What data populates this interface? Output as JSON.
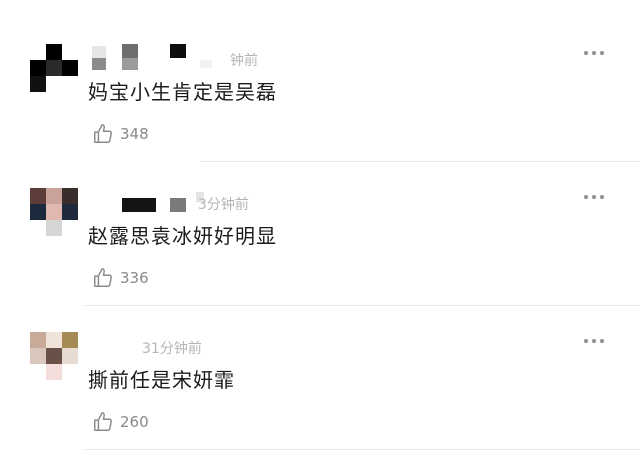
{
  "comments": [
    {
      "time": "钟前",
      "text": "妈宝小生肯定是吴磊",
      "likes": "348",
      "avatar_colors": [
        "#ffffff",
        "#000000",
        "#ffffff",
        "#000000",
        "#2a2a2a",
        "#000000",
        "#111111",
        "#ffffff",
        "#ffffff"
      ],
      "like_icon": "thumbs-up-icon",
      "more_icon": "more-dots-icon"
    },
    {
      "time": "3分钟前",
      "text": "赵露思袁冰妍好明显",
      "likes": "336",
      "avatar_colors": [
        "#5c3d3a",
        "#c9a29a",
        "#3a2e2c",
        "#1c2a3e",
        "#e0b8b0",
        "#1f2b3d",
        "#ffffff",
        "#d6d6d6",
        "#ffffff"
      ],
      "like_icon": "thumbs-up-icon",
      "more_icon": "more-dots-icon"
    },
    {
      "time": "31分钟前",
      "text": "撕前任是宋妍霏",
      "likes": "260",
      "avatar_colors": [
        "#c9a997",
        "#f0e3da",
        "#a58a55",
        "#d9c7bd",
        "#6a5148",
        "#e8dcd2",
        "#ffffff",
        "#f3dedb",
        "#ffffff"
      ],
      "like_icon": "thumbs-up-icon",
      "more_icon": "more-dots-icon"
    }
  ]
}
